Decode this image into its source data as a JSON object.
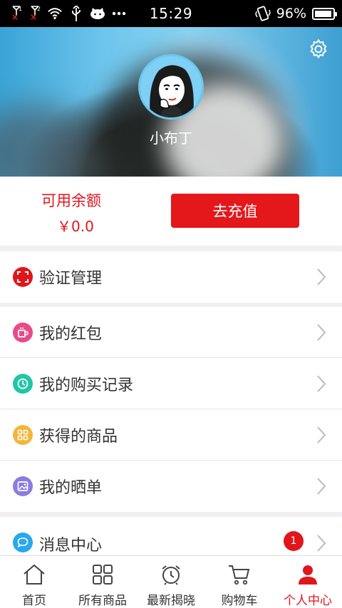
{
  "status_bar": {
    "sim1": "1",
    "sim2": "2",
    "time": "15:29",
    "battery_percent": "96%",
    "battery_level": 0.96
  },
  "profile": {
    "nickname": "小布丁"
  },
  "balance": {
    "label": "可用余额",
    "value": "￥0.0",
    "recharge_label": "去充值"
  },
  "menu": {
    "verify": {
      "label": "验证管理",
      "icon": "scan-icon",
      "color": "#e0161c"
    },
    "items": [
      {
        "label": "我的红包",
        "icon": "cup-icon",
        "color": "#e84b8a"
      },
      {
        "label": "我的购买记录",
        "icon": "clock-icon",
        "color": "#1fc7a5"
      },
      {
        "label": "获得的商品",
        "icon": "grid-icon",
        "color": "#f3b53a"
      },
      {
        "label": "我的晒单",
        "icon": "image-icon",
        "color": "#8c7ce0"
      }
    ],
    "message": {
      "label": "消息中心",
      "icon": "chat-icon",
      "color": "#29a8ec",
      "badge": "1"
    }
  },
  "tabbar": {
    "tabs": [
      {
        "label": "首页",
        "icon": "home-icon"
      },
      {
        "label": "所有商品",
        "icon": "grid-icon"
      },
      {
        "label": "最新揭晓",
        "icon": "alarm-clock-icon"
      },
      {
        "label": "购物车",
        "icon": "cart-icon"
      },
      {
        "label": "个人中心",
        "icon": "person-icon",
        "active": true
      }
    ],
    "active_color": "#e0161c"
  }
}
